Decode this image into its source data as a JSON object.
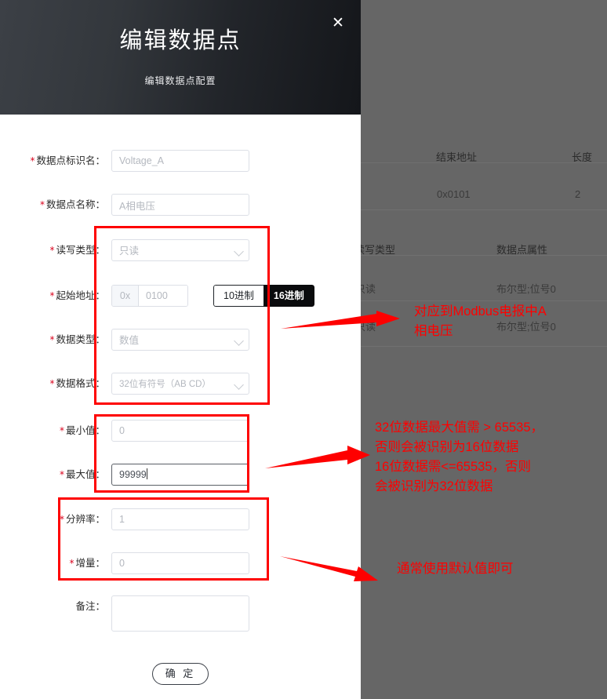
{
  "modal": {
    "title": "编辑数据点",
    "subtitle": "编辑数据点配置",
    "close_icon": "close-icon",
    "close_glyph": "✕",
    "submit_label": "确 定"
  },
  "form": {
    "fields": [
      {
        "label": "数据点标识名：",
        "required": true,
        "type": "input",
        "value": "Voltage_A"
      },
      {
        "label": "数据点名称：",
        "required": true,
        "type": "input",
        "value": "A相电压"
      },
      {
        "label": "读写类型：",
        "required": true,
        "type": "select",
        "value": "只读"
      },
      {
        "label": "起始地址：",
        "required": true,
        "type": "address",
        "prefix": "0x",
        "value": "0100"
      },
      {
        "label": "数据类型：",
        "required": true,
        "type": "select",
        "value": "数值"
      },
      {
        "label": "数据格式：",
        "required": true,
        "type": "select",
        "value": "32位有符号（AB CD）"
      },
      {
        "label": "最小值：",
        "required": true,
        "type": "input",
        "value": "0"
      },
      {
        "label": "最大值：",
        "required": true,
        "type": "input",
        "value": "99999",
        "focused": true
      },
      {
        "label": "分辨率：",
        "required": true,
        "type": "input",
        "value": "1"
      },
      {
        "label": "增量：",
        "required": true,
        "type": "input",
        "value": "0"
      },
      {
        "label": "备注：",
        "required": false,
        "type": "textarea",
        "value": ""
      }
    ],
    "radix_options": [
      {
        "label": "10进制",
        "selected": false
      },
      {
        "label": "16进制",
        "selected": true
      }
    ],
    "required_mark": "*"
  },
  "background_table": {
    "headers_1": [
      "结束地址",
      "长度"
    ],
    "row_1": [
      "0x0101",
      "2"
    ],
    "headers_2": [
      "读写类型",
      "数据点属性"
    ],
    "row_2": [
      "只读",
      "布尔型;位号0"
    ],
    "row_3": [
      "只读",
      "布尔型;位号0"
    ]
  },
  "annotations": {
    "color": "#fe0000",
    "note_1": "对应到Modbus电报中A\n相电压",
    "note_2": "32位数据最大值需 > 65535，\n否则会被识别为16位数据\n16位数据需<=65535，否则\n会被识别为32位数据",
    "note_3": "通常使用默认值即可"
  }
}
